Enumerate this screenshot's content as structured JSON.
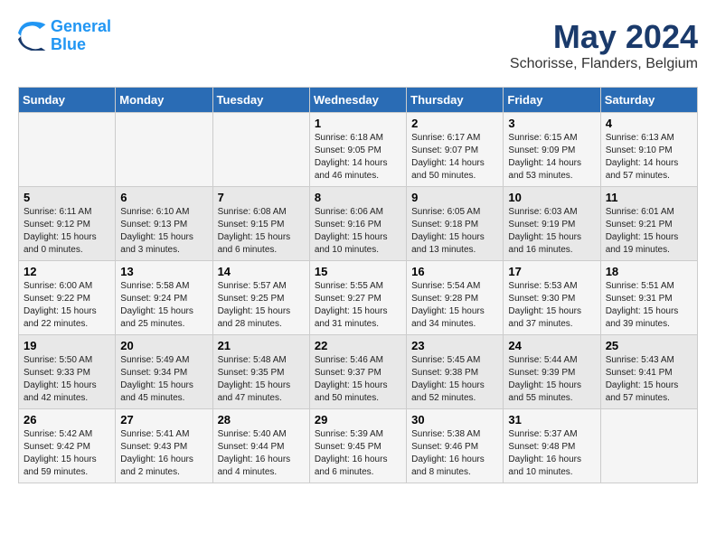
{
  "logo": {
    "line1": "General",
    "line2": "Blue"
  },
  "title": "May 2024",
  "subtitle": "Schorisse, Flanders, Belgium",
  "days_header": [
    "Sunday",
    "Monday",
    "Tuesday",
    "Wednesday",
    "Thursday",
    "Friday",
    "Saturday"
  ],
  "weeks": [
    [
      {
        "day": "",
        "info": ""
      },
      {
        "day": "",
        "info": ""
      },
      {
        "day": "",
        "info": ""
      },
      {
        "day": "1",
        "info": "Sunrise: 6:18 AM\nSunset: 9:05 PM\nDaylight: 14 hours\nand 46 minutes."
      },
      {
        "day": "2",
        "info": "Sunrise: 6:17 AM\nSunset: 9:07 PM\nDaylight: 14 hours\nand 50 minutes."
      },
      {
        "day": "3",
        "info": "Sunrise: 6:15 AM\nSunset: 9:09 PM\nDaylight: 14 hours\nand 53 minutes."
      },
      {
        "day": "4",
        "info": "Sunrise: 6:13 AM\nSunset: 9:10 PM\nDaylight: 14 hours\nand 57 minutes."
      }
    ],
    [
      {
        "day": "5",
        "info": "Sunrise: 6:11 AM\nSunset: 9:12 PM\nDaylight: 15 hours\nand 0 minutes."
      },
      {
        "day": "6",
        "info": "Sunrise: 6:10 AM\nSunset: 9:13 PM\nDaylight: 15 hours\nand 3 minutes."
      },
      {
        "day": "7",
        "info": "Sunrise: 6:08 AM\nSunset: 9:15 PM\nDaylight: 15 hours\nand 6 minutes."
      },
      {
        "day": "8",
        "info": "Sunrise: 6:06 AM\nSunset: 9:16 PM\nDaylight: 15 hours\nand 10 minutes."
      },
      {
        "day": "9",
        "info": "Sunrise: 6:05 AM\nSunset: 9:18 PM\nDaylight: 15 hours\nand 13 minutes."
      },
      {
        "day": "10",
        "info": "Sunrise: 6:03 AM\nSunset: 9:19 PM\nDaylight: 15 hours\nand 16 minutes."
      },
      {
        "day": "11",
        "info": "Sunrise: 6:01 AM\nSunset: 9:21 PM\nDaylight: 15 hours\nand 19 minutes."
      }
    ],
    [
      {
        "day": "12",
        "info": "Sunrise: 6:00 AM\nSunset: 9:22 PM\nDaylight: 15 hours\nand 22 minutes."
      },
      {
        "day": "13",
        "info": "Sunrise: 5:58 AM\nSunset: 9:24 PM\nDaylight: 15 hours\nand 25 minutes."
      },
      {
        "day": "14",
        "info": "Sunrise: 5:57 AM\nSunset: 9:25 PM\nDaylight: 15 hours\nand 28 minutes."
      },
      {
        "day": "15",
        "info": "Sunrise: 5:55 AM\nSunset: 9:27 PM\nDaylight: 15 hours\nand 31 minutes."
      },
      {
        "day": "16",
        "info": "Sunrise: 5:54 AM\nSunset: 9:28 PM\nDaylight: 15 hours\nand 34 minutes."
      },
      {
        "day": "17",
        "info": "Sunrise: 5:53 AM\nSunset: 9:30 PM\nDaylight: 15 hours\nand 37 minutes."
      },
      {
        "day": "18",
        "info": "Sunrise: 5:51 AM\nSunset: 9:31 PM\nDaylight: 15 hours\nand 39 minutes."
      }
    ],
    [
      {
        "day": "19",
        "info": "Sunrise: 5:50 AM\nSunset: 9:33 PM\nDaylight: 15 hours\nand 42 minutes."
      },
      {
        "day": "20",
        "info": "Sunrise: 5:49 AM\nSunset: 9:34 PM\nDaylight: 15 hours\nand 45 minutes."
      },
      {
        "day": "21",
        "info": "Sunrise: 5:48 AM\nSunset: 9:35 PM\nDaylight: 15 hours\nand 47 minutes."
      },
      {
        "day": "22",
        "info": "Sunrise: 5:46 AM\nSunset: 9:37 PM\nDaylight: 15 hours\nand 50 minutes."
      },
      {
        "day": "23",
        "info": "Sunrise: 5:45 AM\nSunset: 9:38 PM\nDaylight: 15 hours\nand 52 minutes."
      },
      {
        "day": "24",
        "info": "Sunrise: 5:44 AM\nSunset: 9:39 PM\nDaylight: 15 hours\nand 55 minutes."
      },
      {
        "day": "25",
        "info": "Sunrise: 5:43 AM\nSunset: 9:41 PM\nDaylight: 15 hours\nand 57 minutes."
      }
    ],
    [
      {
        "day": "26",
        "info": "Sunrise: 5:42 AM\nSunset: 9:42 PM\nDaylight: 15 hours\nand 59 minutes."
      },
      {
        "day": "27",
        "info": "Sunrise: 5:41 AM\nSunset: 9:43 PM\nDaylight: 16 hours\nand 2 minutes."
      },
      {
        "day": "28",
        "info": "Sunrise: 5:40 AM\nSunset: 9:44 PM\nDaylight: 16 hours\nand 4 minutes."
      },
      {
        "day": "29",
        "info": "Sunrise: 5:39 AM\nSunset: 9:45 PM\nDaylight: 16 hours\nand 6 minutes."
      },
      {
        "day": "30",
        "info": "Sunrise: 5:38 AM\nSunset: 9:46 PM\nDaylight: 16 hours\nand 8 minutes."
      },
      {
        "day": "31",
        "info": "Sunrise: 5:37 AM\nSunset: 9:48 PM\nDaylight: 16 hours\nand 10 minutes."
      },
      {
        "day": "",
        "info": ""
      }
    ]
  ]
}
